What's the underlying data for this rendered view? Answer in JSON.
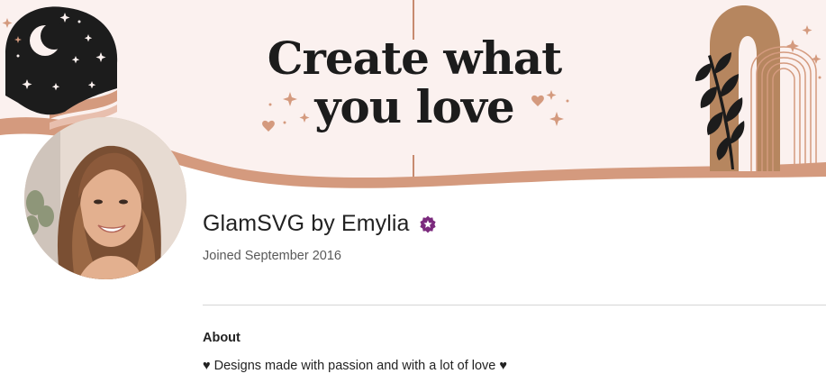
{
  "banner": {
    "headline_line1": "Create what",
    "headline_line2": "you love",
    "colors": {
      "background": "#fbf1ef",
      "accent_tan": "#d49a7e",
      "dark": "#1c1c1c"
    },
    "icons": [
      "crescent-moon-icon",
      "stars-icon",
      "arch-icon",
      "palm-leaf-icon",
      "heart-icon",
      "sparkle-icon"
    ]
  },
  "profile": {
    "shop_name": "GlamSVG by Emylia",
    "badge_icon": "star-seller-badge-icon",
    "badge_color": "#7b2a7d",
    "joined": "Joined September 2016"
  },
  "about": {
    "heading": "About",
    "text": "♥ Designs made with passion and with a lot of love ♥"
  }
}
